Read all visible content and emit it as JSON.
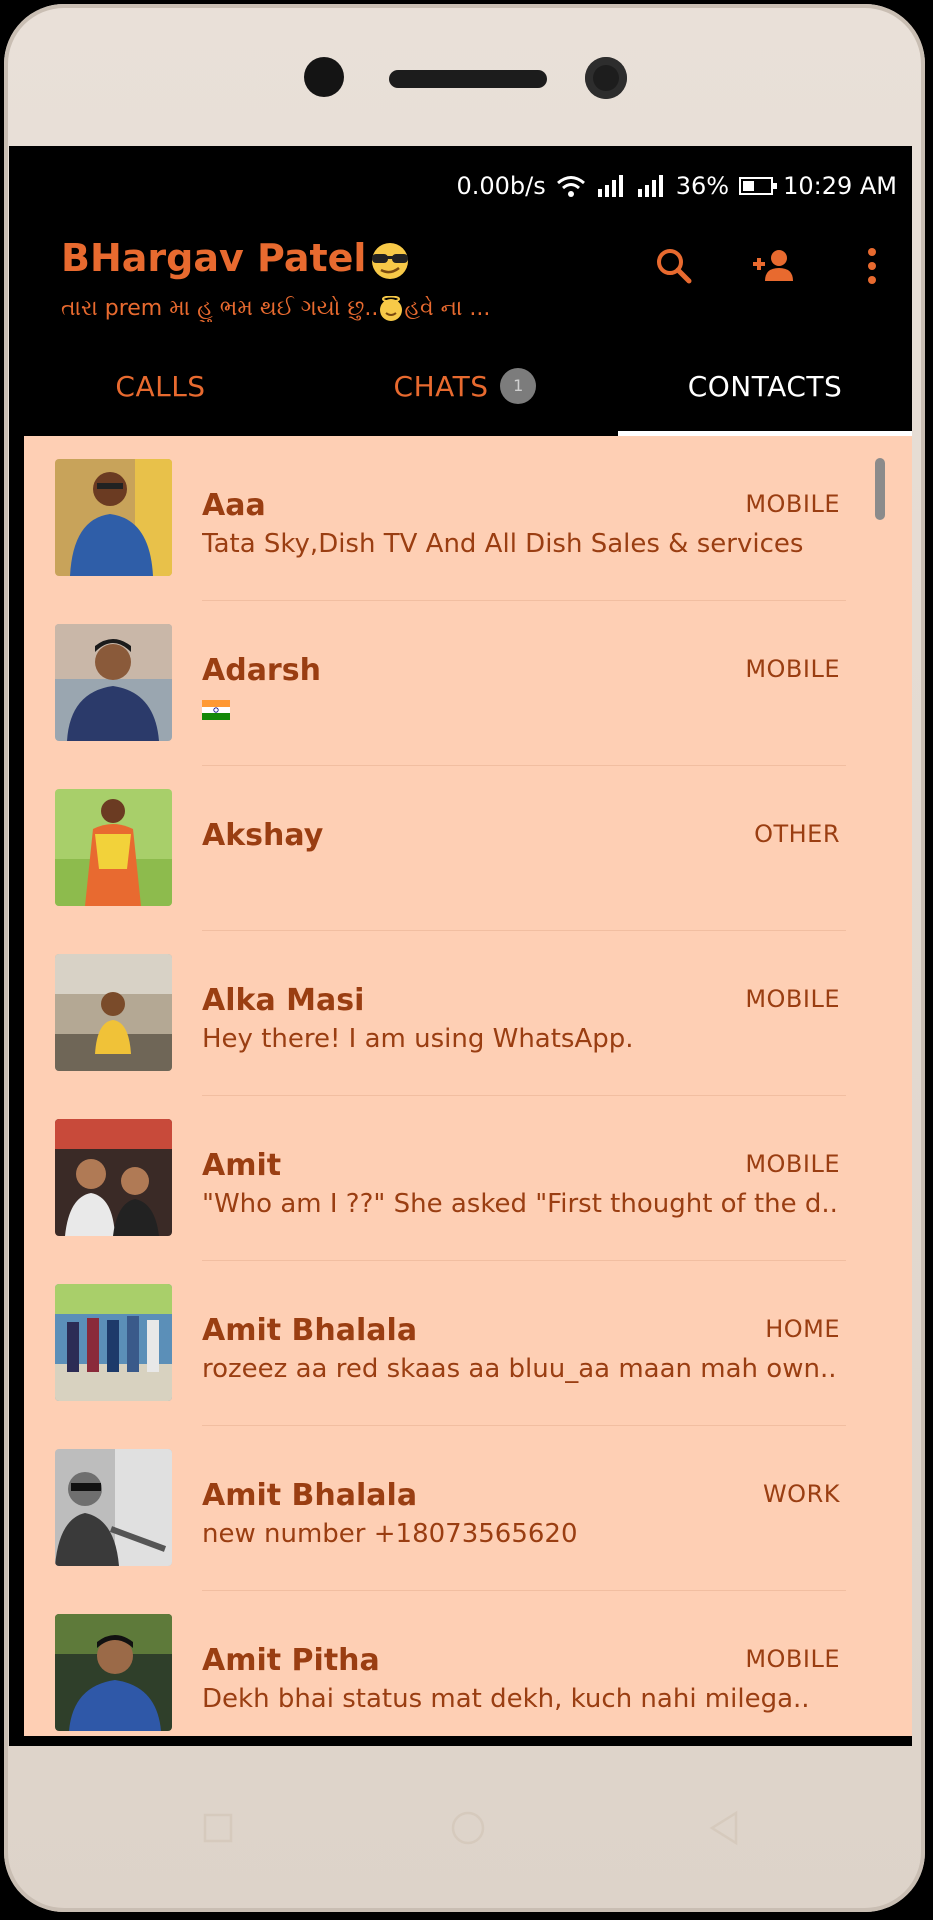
{
  "status_bar": {
    "speed": "0.00b/s",
    "battery": "36%",
    "time": "10:29 AM"
  },
  "header": {
    "title": "BHargav Patel",
    "subtitle": "તારા prem મા હુ ભમ થઈ ગયો છુ..😇ℓℓσнєє ના ...",
    "subtitle_main": "તારા prem મા હુ ભમ થઈ ગયો છુ..",
    "subtitle_tail": "હવે ના ...",
    "icons": [
      "search-icon",
      "add-contact-icon",
      "more-vert-icon"
    ]
  },
  "tabs": [
    {
      "label": "CALLS"
    },
    {
      "label": "CHATS",
      "badge": "1"
    },
    {
      "label": "CONTACTS",
      "active": true
    }
  ],
  "contacts": [
    {
      "name": "Aaa",
      "type": "MOBILE",
      "status": "Tata Sky,Dish TV And All Dish Sales & services"
    },
    {
      "name": "Adarsh",
      "type": "MOBILE",
      "status": "🇮🇳"
    },
    {
      "name": "Akshay",
      "type": "OTHER",
      "status": ""
    },
    {
      "name": "Alka Masi",
      "type": "MOBILE",
      "status": "Hey there! I am using WhatsApp."
    },
    {
      "name": "Amit",
      "type": "MOBILE",
      "status": "\"Who am I ??\"  She asked  \"First thought of the d.."
    },
    {
      "name": "Amit Bhalala",
      "type": "HOME",
      "status": "rozeez aa red skaas aa bluu_aa maan mah own.."
    },
    {
      "name": "Amit Bhalala",
      "type": "WORK",
      "status": "new number +18073565620"
    },
    {
      "name": "Amit Pitha",
      "type": "MOBILE",
      "status": "Dekh bhai status mat dekh, kuch nahi milega.."
    }
  ],
  "colors": {
    "accent": "#e86a2f",
    "list_bg": "#fecfb4",
    "text_dark": "#9a3e12"
  },
  "nav_icons": [
    "recents-square-icon",
    "home-circle-icon",
    "back-triangle-icon"
  ]
}
